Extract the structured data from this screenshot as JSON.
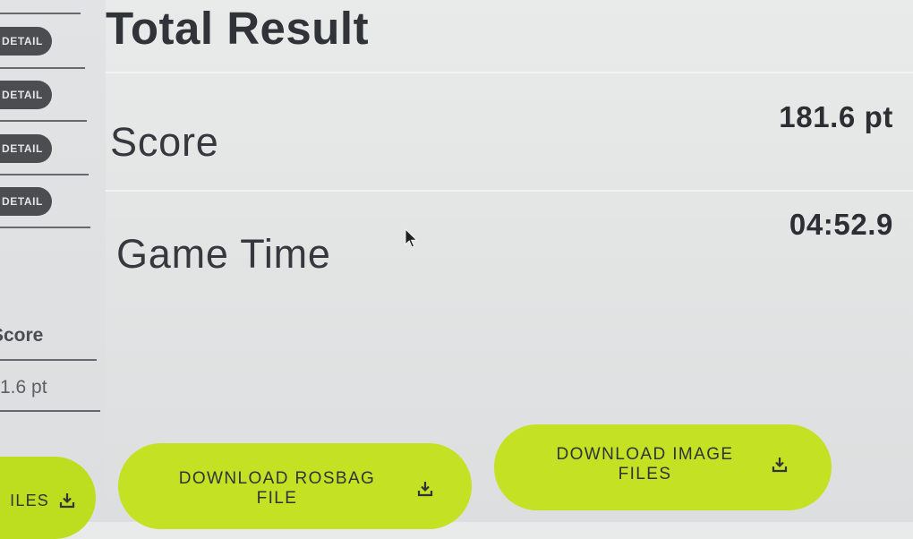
{
  "sidebar": {
    "detail_buttons": [
      "DETAIL",
      "DETAIL",
      "DETAIL",
      "DETAIL"
    ],
    "score_label": "Score",
    "score_value": "1.6 pt",
    "files_button_label": "ILES"
  },
  "main": {
    "title": "Total Result",
    "rows": [
      {
        "label": "Score",
        "value": "181.6 pt"
      },
      {
        "label": "Game Time",
        "value": "04:52.9"
      }
    ]
  },
  "actions": {
    "download_rosbag": "DOWNLOAD ROSBAG FILE",
    "download_images": "DOWNLOAD IMAGE FILES"
  },
  "icons": {
    "download": "download-icon",
    "cursor": "mouse-cursor-icon"
  },
  "colors": {
    "accent_green": "#c4e124",
    "pill_dark": "#4b4d50",
    "text_dark": "#2f3438",
    "background": "#e4e6e6"
  }
}
